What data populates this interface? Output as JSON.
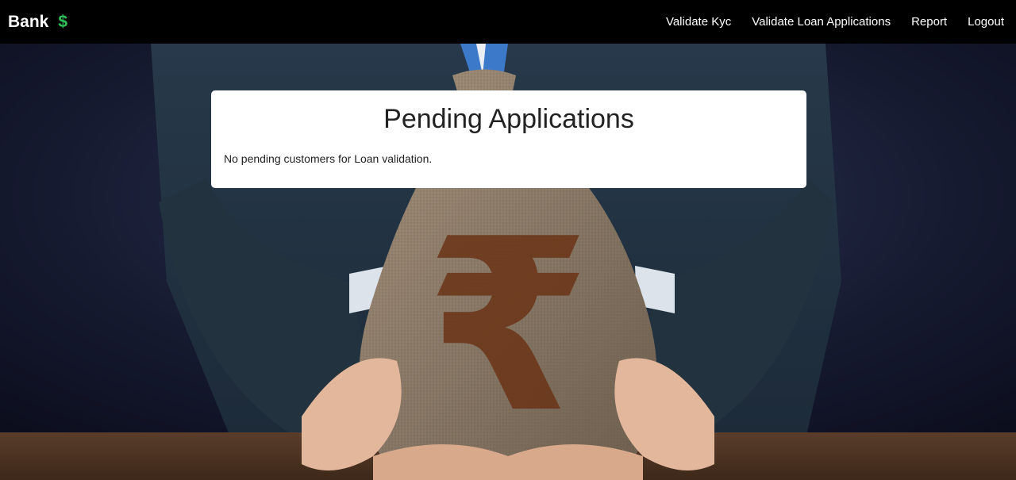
{
  "navbar": {
    "brand": "Bank",
    "brand_icon": "dollar-icon",
    "brand_icon_glyph": "$",
    "links": [
      "Validate Kyc",
      "Validate Loan Applications",
      "Report",
      "Logout"
    ]
  },
  "main": {
    "title": "Pending Applications",
    "message": "No pending customers for Loan validation.",
    "hero_image": "money-bag-rupee-image",
    "hero_glyph": "₹"
  },
  "colors": {
    "navbar_bg": "#000000",
    "brand_icon": "#2fc25b",
    "card_bg": "#ffffff"
  }
}
